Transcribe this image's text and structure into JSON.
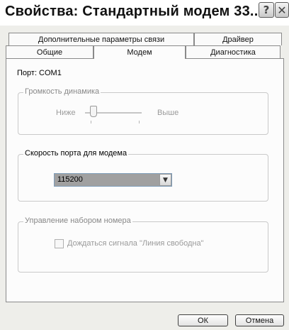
{
  "window": {
    "title": "Свойства: Стандартный модем 33...",
    "help_glyph": "?",
    "close_glyph": "✕"
  },
  "tabs": {
    "row1": [
      "Дополнительные параметры связи",
      "Драйвер"
    ],
    "row2": [
      "Общие",
      "Модем",
      "Диагностика"
    ],
    "selected": "Модем"
  },
  "port": {
    "label": "Порт: COM1"
  },
  "volume": {
    "group_label": "Громкость динамика",
    "low_label": "Ниже",
    "high_label": "Выше",
    "level": 0.1,
    "enabled": false
  },
  "speed": {
    "group_label": "Скорость порта для модема",
    "value": "115200",
    "arrow_glyph": "▼"
  },
  "dial": {
    "group_label": "Управление набором номера",
    "checkbox_label": "Дождаться сигнала \"Линия свободна\"",
    "checked": false,
    "enabled": false
  },
  "buttons": {
    "ok": "ОК",
    "cancel": "Отмена"
  }
}
